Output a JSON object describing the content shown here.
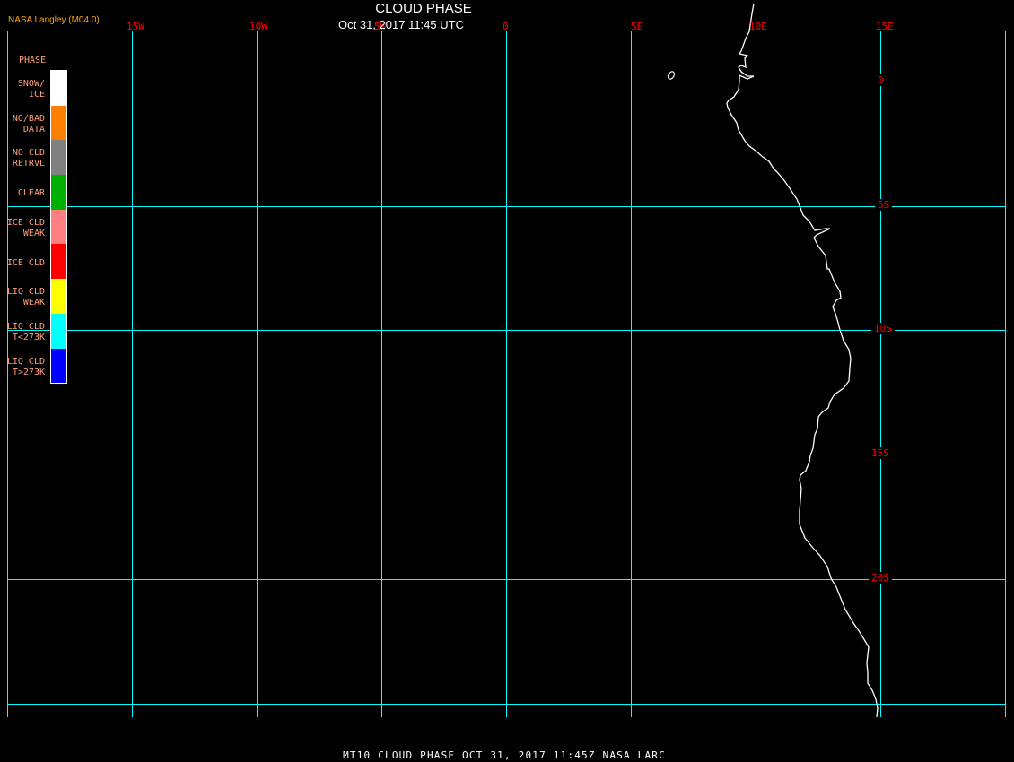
{
  "header": {
    "title": "CLOUD PHASE",
    "subtitle": "Oct 31, 2017 11:45 UTC",
    "credit": "NASA Langley (M04.0)"
  },
  "map": {
    "grid_color": "#00ffff",
    "label_color": "#ff0000",
    "coastline_color": "#ffffff",
    "longitude_labels": [
      "15W",
      "10W",
      "5W",
      "0",
      "5E",
      "10E",
      "15E"
    ],
    "latitude_labels": [
      "0",
      "5S",
      "10S",
      "15S",
      "20S"
    ]
  },
  "legend": {
    "title": "PHASE",
    "items": [
      {
        "line1": "SNOW/",
        "line2": "ICE",
        "color": "#ffffff"
      },
      {
        "line1": "NO/BAD",
        "line2": "DATA",
        "color": "#ff8000"
      },
      {
        "line1": "NO CLD",
        "line2": "RETRVL",
        "color": "#808080"
      },
      {
        "line1": "CLEAR",
        "line2": "",
        "color": "#00b000"
      },
      {
        "line1": "ICE CLD",
        "line2": "WEAK",
        "color": "#ff8080"
      },
      {
        "line1": "ICE CLD",
        "line2": "",
        "color": "#ff0000"
      },
      {
        "line1": "LIQ CLD",
        "line2": "WEAK",
        "color": "#ffff00"
      },
      {
        "line1": "LIQ CLD",
        "line2": "T<273K",
        "color": "#00ffff"
      },
      {
        "line1": "LIQ CLD",
        "line2": "T>273K",
        "color": "#0000ff"
      }
    ]
  },
  "footer": "MT10  CLOUD PHASE  OCT 31, 2017 11:45Z  NASA LARC"
}
